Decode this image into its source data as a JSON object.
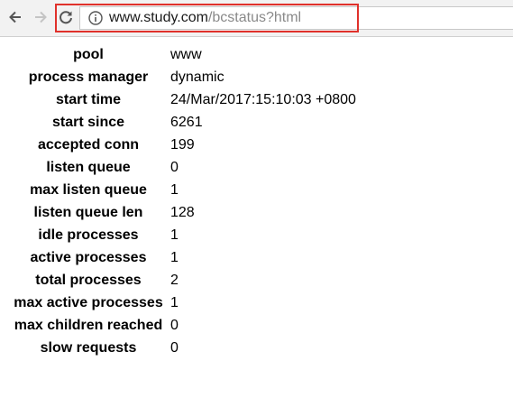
{
  "browser": {
    "url_host": "www.study.com",
    "url_path": "/bcstatus?html",
    "highlight_color": "#e0312b"
  },
  "status": [
    {
      "key": "pool",
      "value": "www"
    },
    {
      "key": "process manager",
      "value": "dynamic"
    },
    {
      "key": "start time",
      "value": "24/Mar/2017:15:10:03 +0800"
    },
    {
      "key": "start since",
      "value": "6261"
    },
    {
      "key": "accepted conn",
      "value": "199"
    },
    {
      "key": "listen queue",
      "value": "0"
    },
    {
      "key": "max listen queue",
      "value": "1"
    },
    {
      "key": "listen queue len",
      "value": "128"
    },
    {
      "key": "idle processes",
      "value": "1"
    },
    {
      "key": "active processes",
      "value": "1"
    },
    {
      "key": "total processes",
      "value": "2"
    },
    {
      "key": "max active processes",
      "value": "1"
    },
    {
      "key": "max children reached",
      "value": "0"
    },
    {
      "key": "slow requests",
      "value": "0"
    }
  ]
}
